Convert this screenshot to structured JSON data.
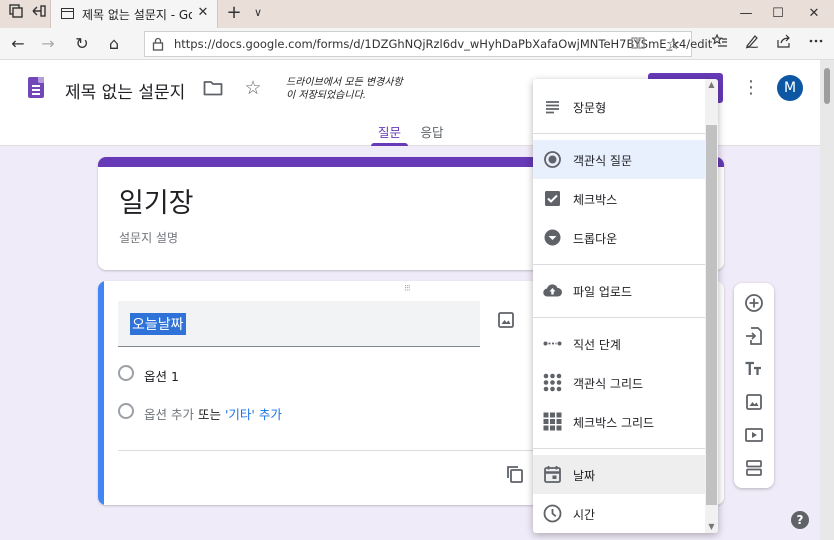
{
  "browser": {
    "tab_title": "제목 없는 설문지 - Google Forms",
    "url": "https://docs.google.com/forms/d/1DZGhNQjRzl6dv_wHyhDaPbXafaOwjMNTeH7BYSmE_k4/edit",
    "new_tab_glyph": "+",
    "tab_menu_glyph": "∨",
    "close_glyph": "✕",
    "minimize_glyph": "—",
    "maximize_glyph": "☐",
    "back_glyph": "←",
    "forward_glyph": "→",
    "refresh_glyph": "↻",
    "home_glyph": "⌂",
    "favorite_glyph": "☆"
  },
  "header": {
    "doc_title": "제목 없는 설문지",
    "save_status_line1": "드라이브에서 모든 변경사항",
    "save_status_line2": "이 저장되었습니다.",
    "avatar_letter": "M",
    "star_glyph": "☆",
    "more_glyph": "⋮",
    "tabs": [
      {
        "label": "질문"
      },
      {
        "label": "응답"
      }
    ]
  },
  "form": {
    "title": "일기장",
    "description": "설문지 설명"
  },
  "question": {
    "title": "오늘날짜",
    "option1": "옵션 1",
    "add_option": "옵션 추가",
    "or_text": "또는",
    "add_other": "'기타' 추가"
  },
  "menu": {
    "items": [
      {
        "label": "장문형",
        "icon": "paragraph-icon"
      },
      {
        "label": "객관식 질문",
        "icon": "radio-icon"
      },
      {
        "label": "체크박스",
        "icon": "checkbox-icon"
      },
      {
        "label": "드롭다운",
        "icon": "dropdown-icon"
      },
      {
        "label": "파일 업로드",
        "icon": "upload-icon"
      },
      {
        "label": "직선 단계",
        "icon": "linear-scale-icon"
      },
      {
        "label": "객관식 그리드",
        "icon": "grid-icon"
      },
      {
        "label": "체크박스 그리드",
        "icon": "checkbox-grid-icon"
      },
      {
        "label": "날짜",
        "icon": "date-icon"
      },
      {
        "label": "시간",
        "icon": "time-icon"
      }
    ]
  },
  "colors": {
    "accent": "#673ab7",
    "background": "#f0ebf8",
    "selection": "#2f73d8",
    "link": "#1a73e8"
  }
}
